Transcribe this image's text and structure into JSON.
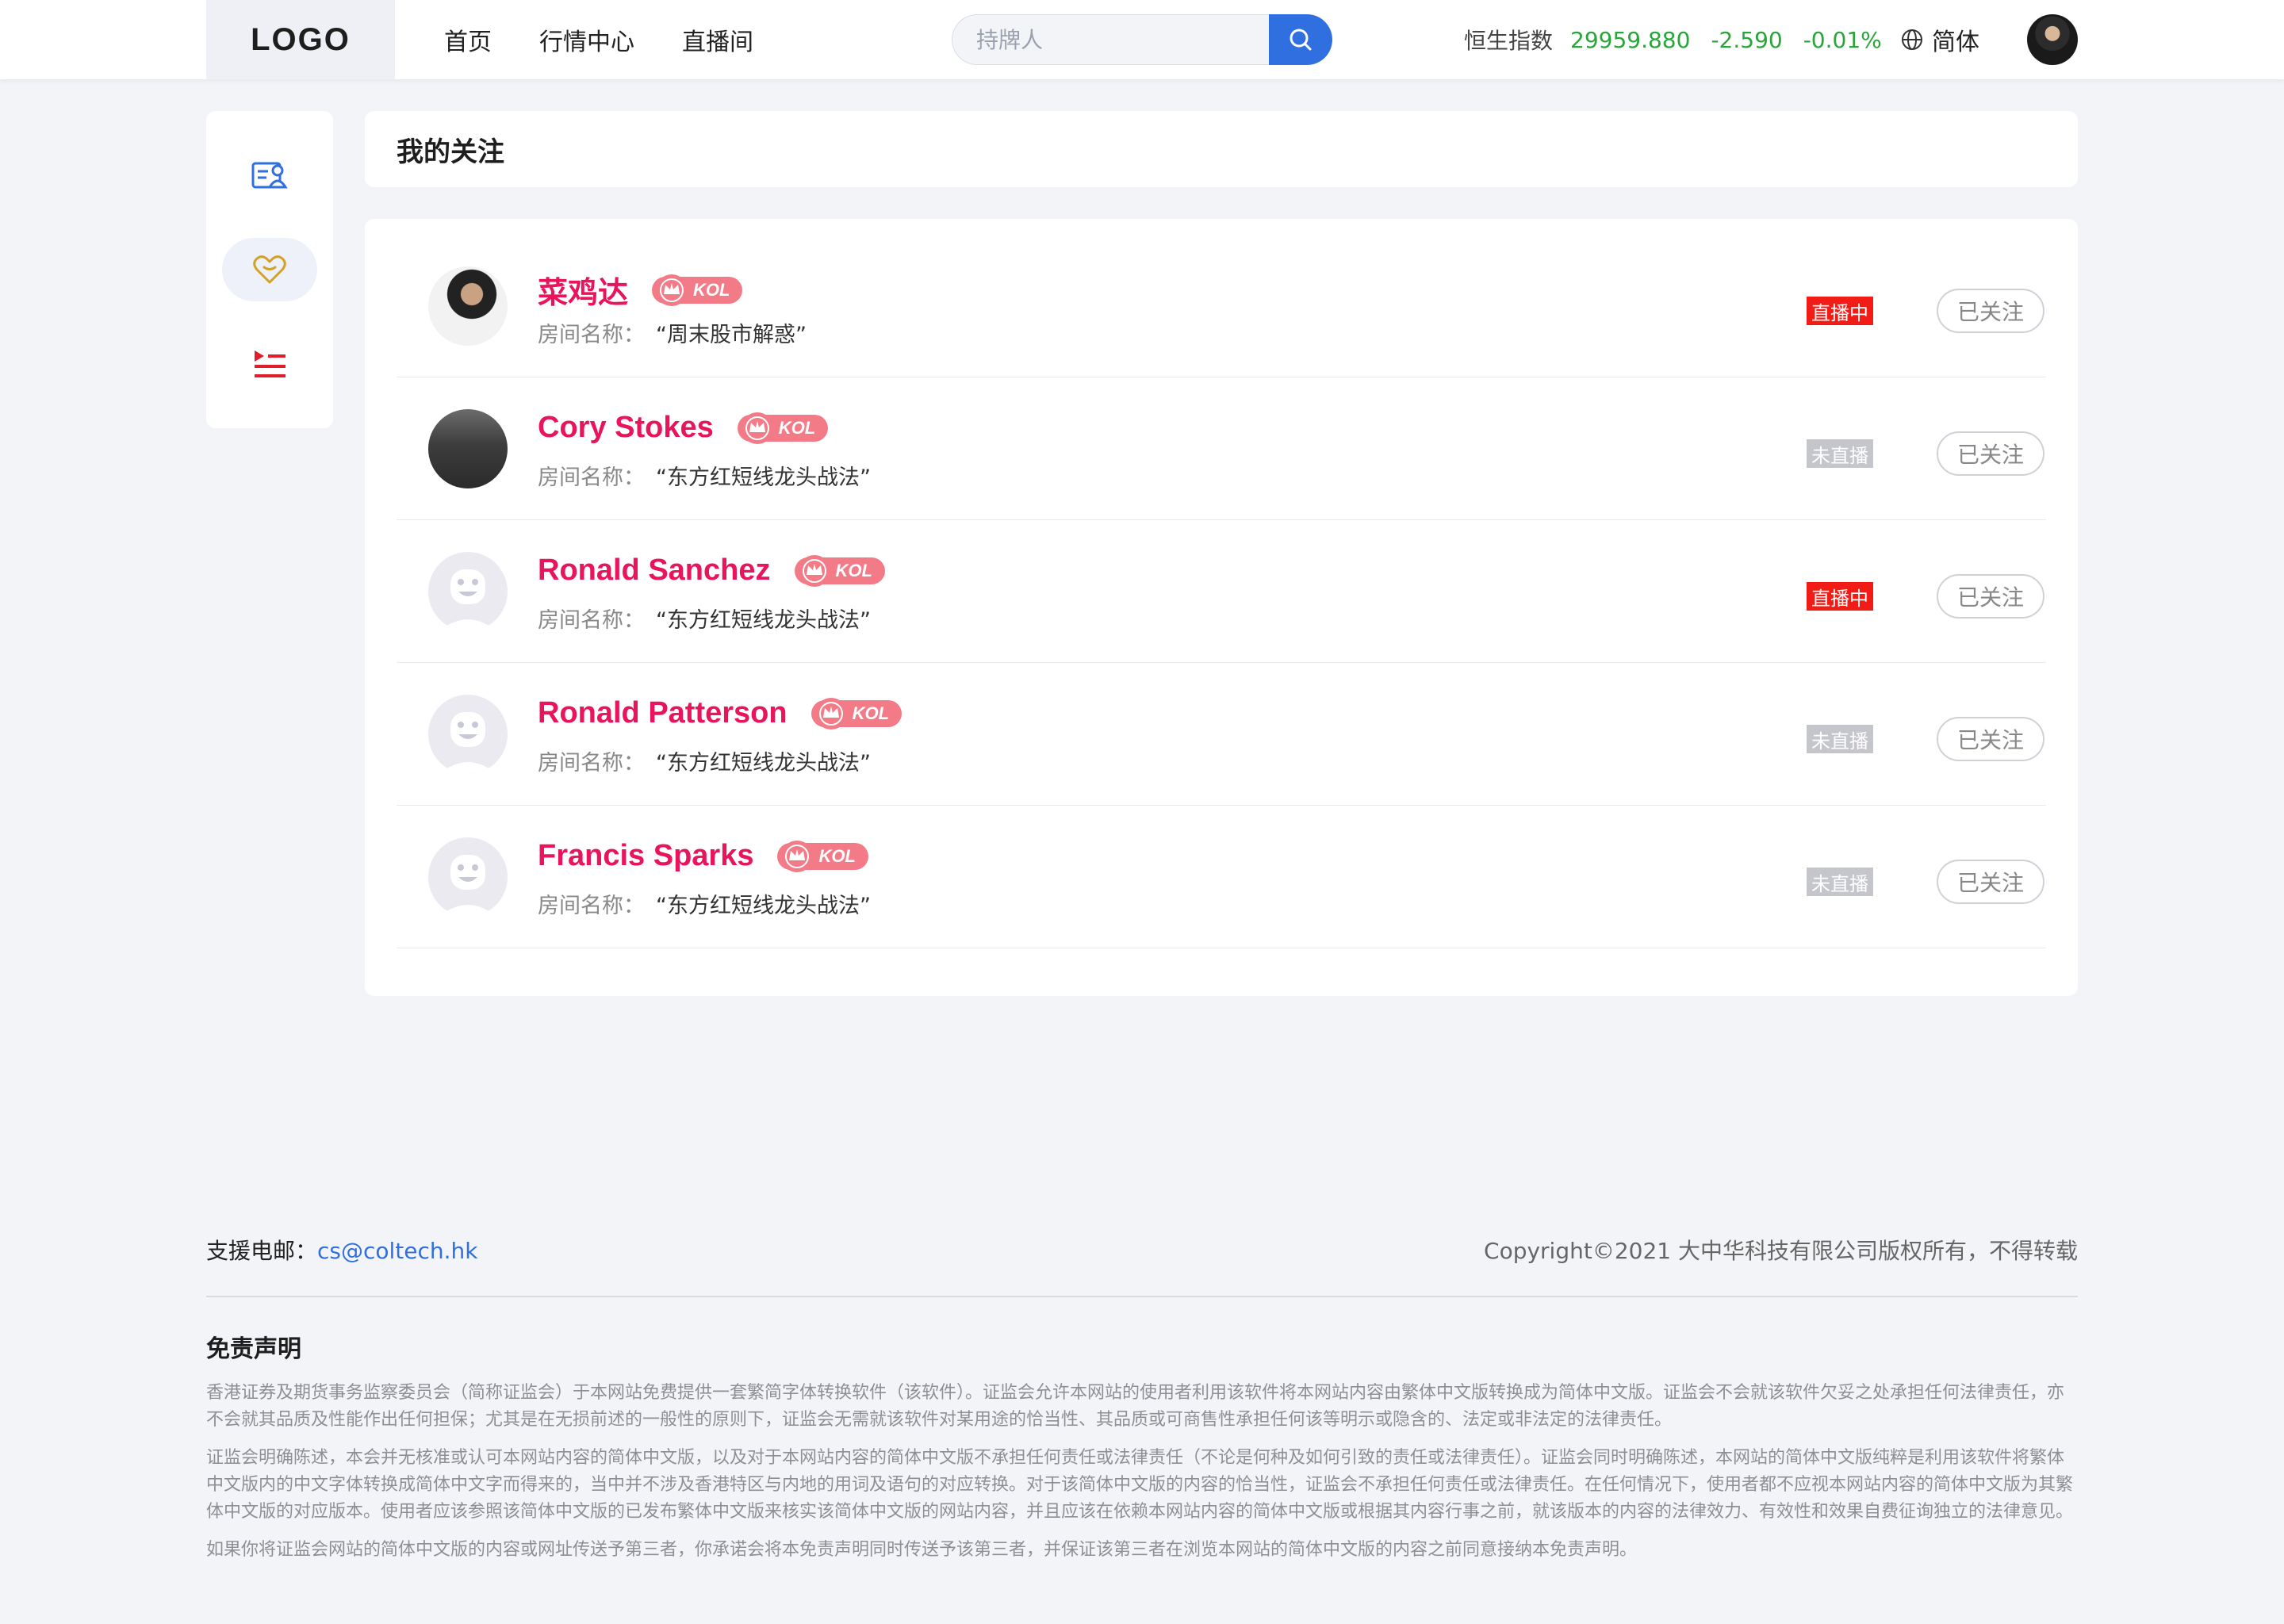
{
  "header": {
    "logo": "LOGO",
    "nav": [
      "首页",
      "行情中心",
      "直播间"
    ],
    "search_placeholder": "持牌人",
    "index": {
      "name": "恒生指数",
      "value": "29959.880",
      "change": "-2.590",
      "percent": "-0.01%"
    },
    "language": "简体"
  },
  "page": {
    "title": "我的关注"
  },
  "follows": [
    {
      "name": "菜鸡达",
      "badge": "KOL",
      "room_label": "房间名称：",
      "room": "“周末股市解惑”",
      "status": "直播中",
      "live": true,
      "button": "已关注"
    },
    {
      "name": "Cory Stokes",
      "badge": "KOL",
      "room_label": "房间名称：",
      "room": "“东方红短线龙头战法”",
      "status": "未直播",
      "live": false,
      "button": "已关注"
    },
    {
      "name": "Ronald Sanchez",
      "badge": "KOL",
      "room_label": "房间名称：",
      "room": "“东方红短线龙头战法”",
      "status": "直播中",
      "live": true,
      "button": "已关注"
    },
    {
      "name": "Ronald Patterson",
      "badge": "KOL",
      "room_label": "房间名称：",
      "room": "“东方红短线龙头战法”",
      "status": "未直播",
      "live": false,
      "button": "已关注"
    },
    {
      "name": "Francis Sparks",
      "badge": "KOL",
      "room_label": "房间名称：",
      "room": "“东方红短线龙头战法”",
      "status": "未直播",
      "live": false,
      "button": "已关注"
    }
  ],
  "footer": {
    "contact_label": "支援电邮：",
    "email": "cs@coltech.hk",
    "copyright": "Copyright©2021 大中华科技有限公司版权所有，不得转载",
    "disclaimer_title": "免责声明",
    "disclaimer": [
      "香港证券及期货事务监察委员会（简称证监会）于本网站免费提供一套繁简字体转换软件（该软件）。证监会允许本网站的使用者利用该软件将本网站内容由繁体中文版转换成为简体中文版。证监会不会就该软件欠妥之处承担任何法律责任，亦不会就其品质及性能作出任何担保；尤其是在无损前述的一般性的原则下，证监会无需就该软件对某用途的恰当性、其品质或可商售性承担任何该等明示或隐含的、法定或非法定的法律责任。",
      "证监会明确陈述，本会并无核准或认可本网站内容的简体中文版，以及对于本网站内容的简体中文版不承担任何责任或法律责任（不论是何种及如何引致的责任或法律责任）。证监会同时明确陈述，本网站的简体中文版纯粹是利用该软件将繁体中文版内的中文字体转换成简体中文字而得来的，当中并不涉及香港特区与内地的用词及语句的对应转换。对于该简体中文版的内容的恰当性，证监会不承担任何责任或法律责任。在任何情况下，使用者都不应视本网站内容的简体中文版为其繁体中文版的对应版本。使用者应该参照该简体中文版的已发布繁体中文版来核实该简体中文版的网站内容，并且应该在依赖本网站内容的简体中文版或根据其内容行事之前，就该版本的内容的法律效力、有效性和效果自费征询独立的法律意见。",
      "如果你将证监会网站的简体中文版的内容或网址传送予第三者，你承诺会将本免责声明同时传送予该第三者，并保证该第三者在浏览本网站的简体中文版的内容之前同意接纳本免责声明。"
    ]
  },
  "colors": {
    "brand": "#2f6fe0",
    "kol_name": "#e8145c",
    "live": "#f21c17",
    "offline": "#c4c6cc",
    "up_green": "#2aa53a"
  }
}
